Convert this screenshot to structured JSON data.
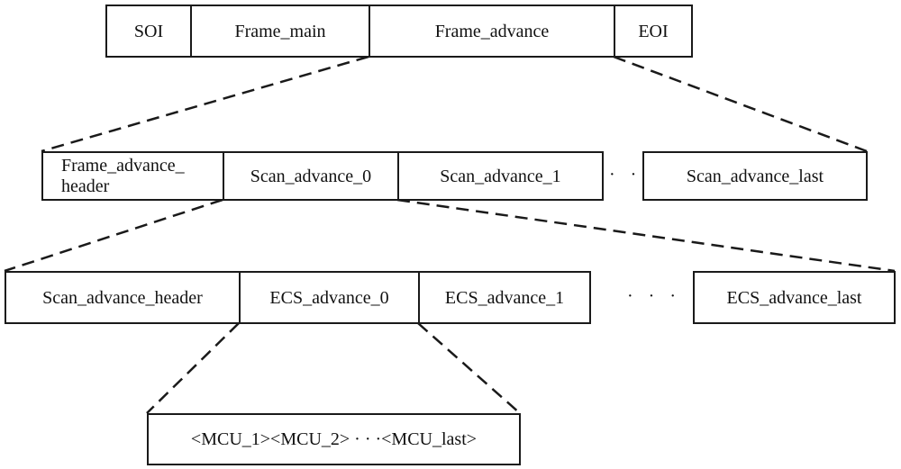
{
  "diagram": {
    "level1": {
      "segments": [
        "SOI",
        "Frame_main",
        "Frame_advance",
        "EOI"
      ],
      "expanded": "Frame_advance"
    },
    "level2": {
      "segments": [
        "Frame_advance_\nheader",
        "Scan_advance_0",
        "Scan_advance_1",
        "Scan_advance_last"
      ],
      "ellipsis": "· · ·",
      "expanded": "Scan_advance_0"
    },
    "level3": {
      "segments": [
        "Scan_advance_header",
        "ECS_advance_0",
        "ECS_advance_1",
        "ECS_advance_last"
      ],
      "ellipsis": "· · ·",
      "expanded": "ECS_advance_0"
    },
    "level4": {
      "content": "<MCU_1><MCU_2> · · ·<MCU_last>"
    },
    "line_color": "#1a1a1a",
    "connector_style": "dashed"
  }
}
